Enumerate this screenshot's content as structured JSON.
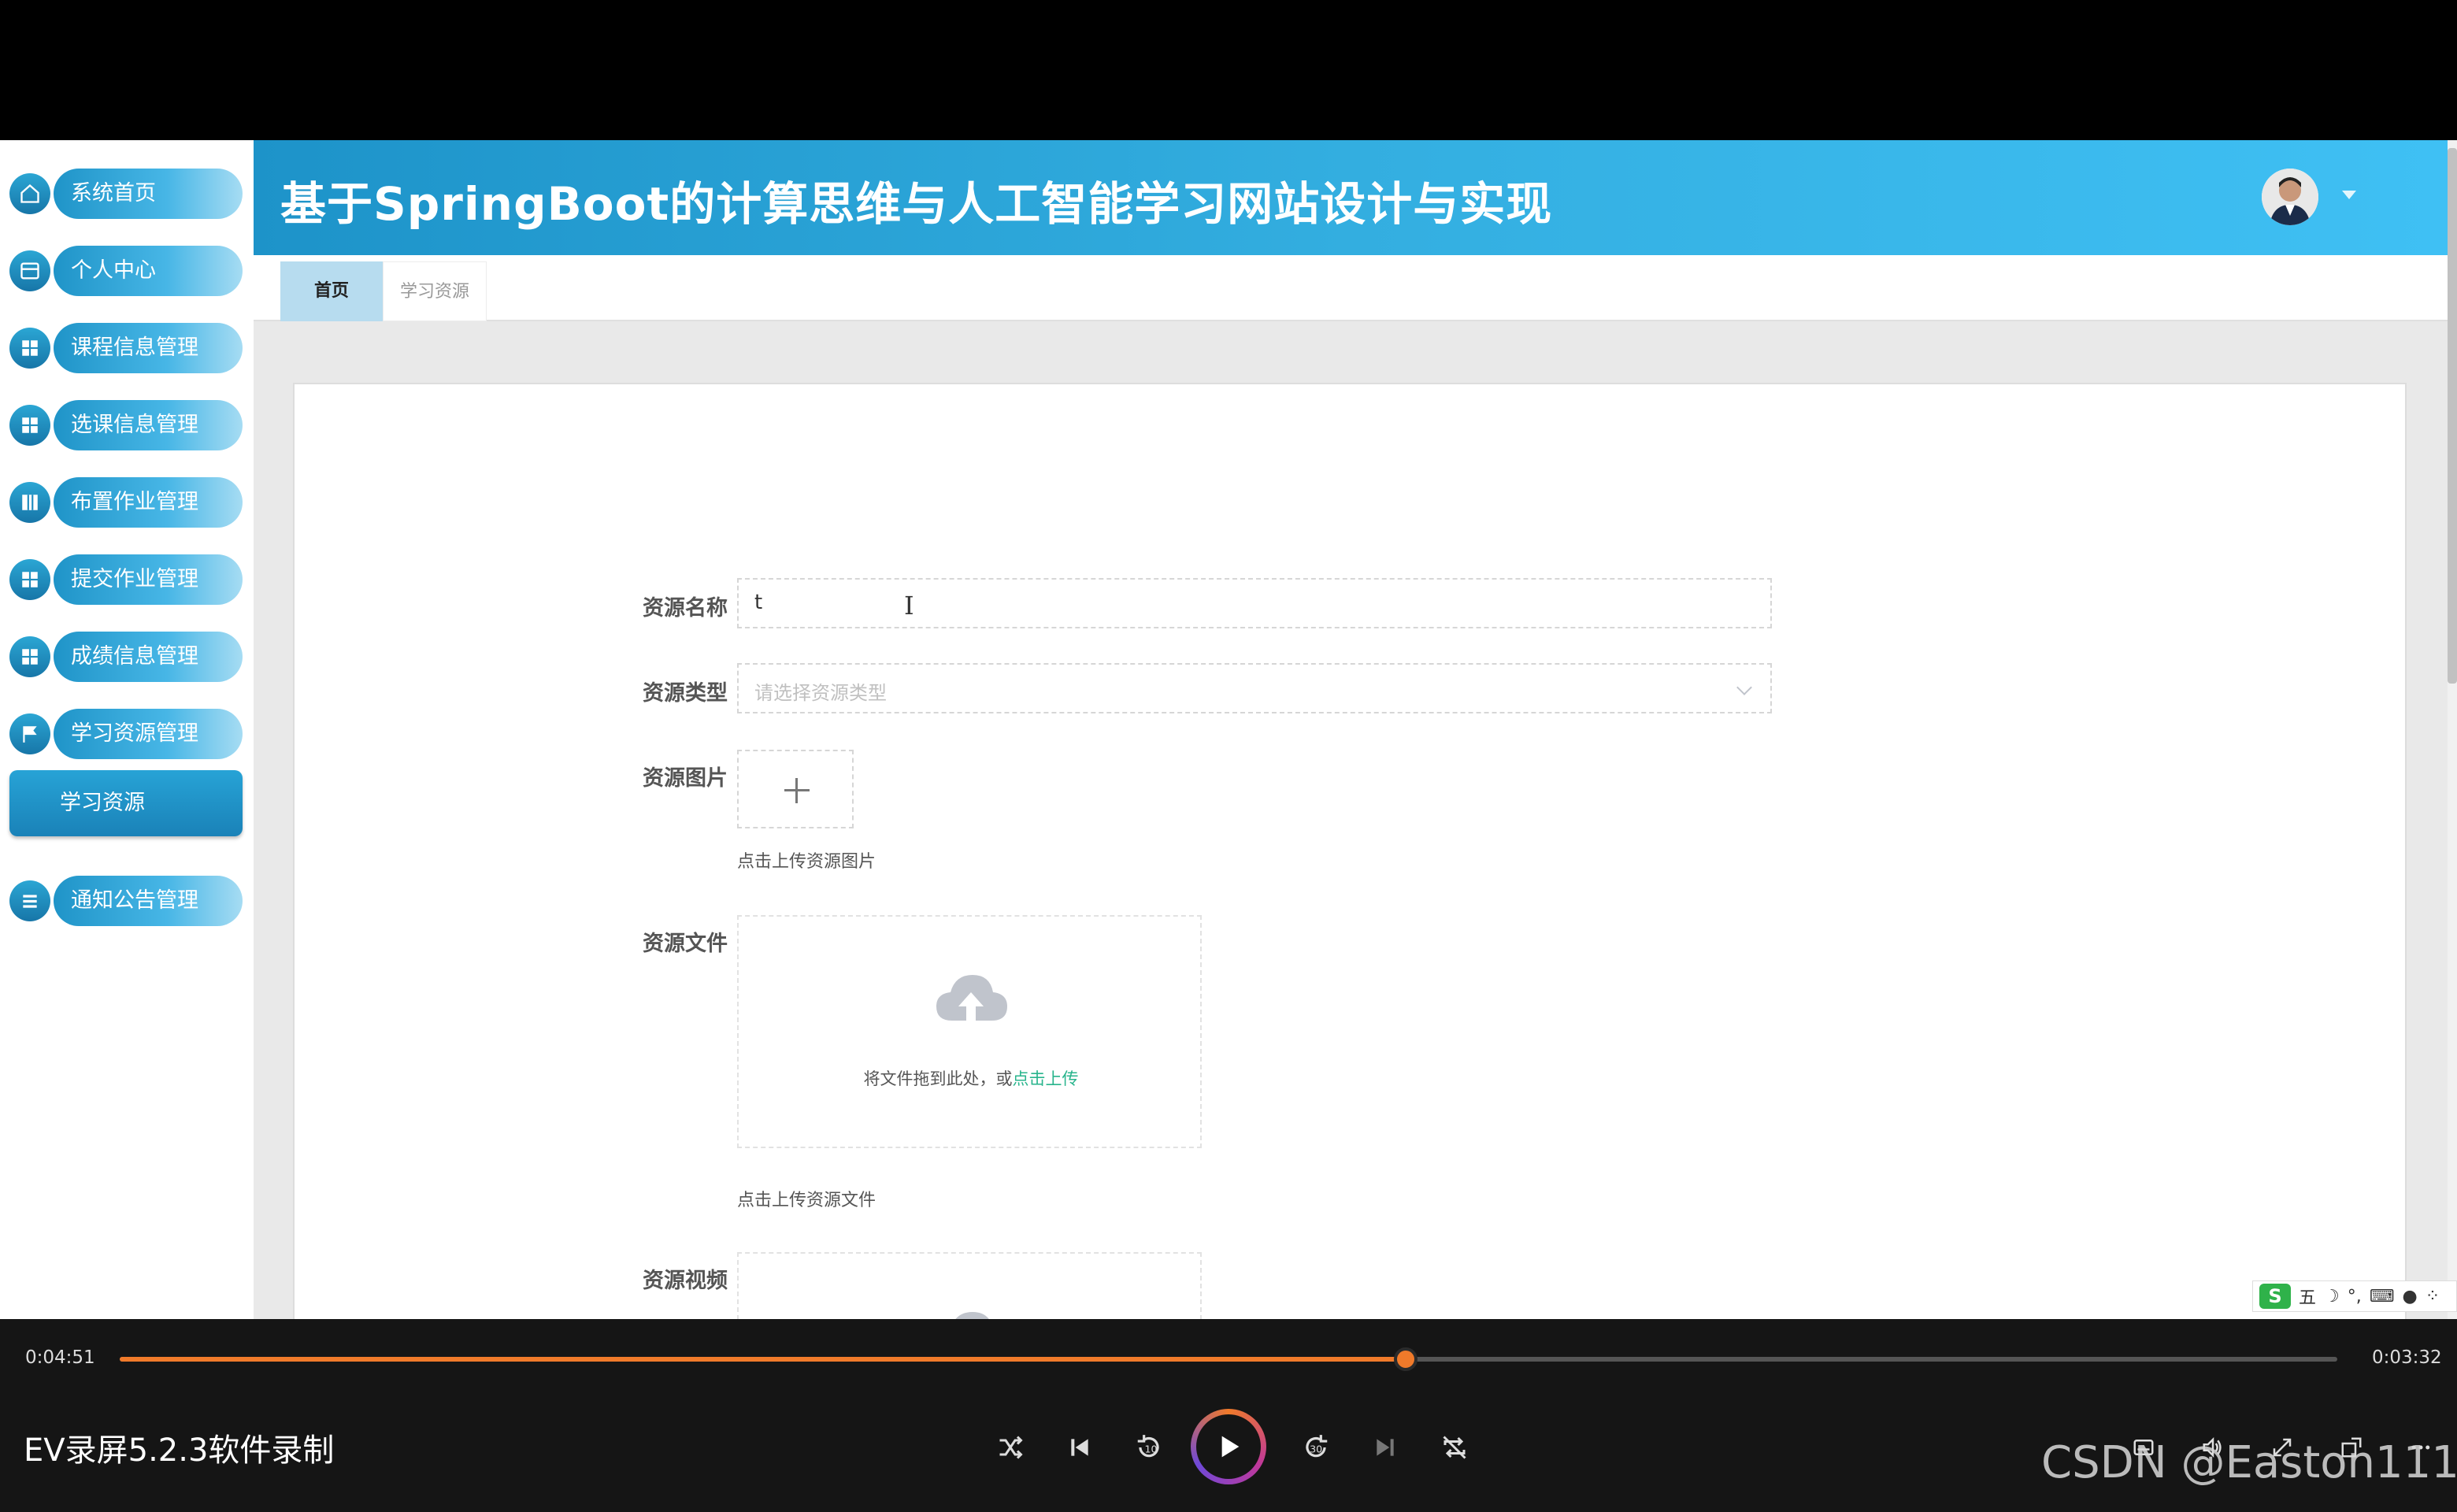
{
  "header": {
    "title": "基于SpringBoot的计算思维与人工智能学习网站设计与实现"
  },
  "sidebar": {
    "items": [
      {
        "label": "系统首页",
        "icon": "home-icon"
      },
      {
        "label": "个人中心",
        "icon": "profile-icon"
      },
      {
        "label": "课程信息管理",
        "icon": "grid-icon"
      },
      {
        "label": "选课信息管理",
        "icon": "grid-icon"
      },
      {
        "label": "布置作业管理",
        "icon": "book-icon"
      },
      {
        "label": "提交作业管理",
        "icon": "grid-icon"
      },
      {
        "label": "成绩信息管理",
        "icon": "grid-icon"
      },
      {
        "label": "学习资源管理",
        "icon": "flag-icon"
      },
      {
        "label": "通知公告管理",
        "icon": "list-icon"
      }
    ],
    "sub_item": "学习资源"
  },
  "tabs": [
    {
      "label": "首页",
      "active": true
    },
    {
      "label": "学习资源",
      "active": false
    }
  ],
  "form": {
    "name_label": "资源名称",
    "name_value": "t",
    "type_label": "资源类型",
    "type_placeholder": "请选择资源类型",
    "image_label": "资源图片",
    "image_hint": "点击上传资源图片",
    "file_label": "资源文件",
    "file_hint": "点击上传资源文件",
    "video_label": "资源视频",
    "drop_text": "将文件拖到此处，或",
    "drop_link": "点击上传"
  },
  "ime": {
    "logo": "S",
    "mode": "五"
  },
  "player": {
    "elapsed": "0:04:51",
    "remaining": "0:03:32",
    "progress_fraction": 0.58,
    "title": "EV录屏5.2.3软件录制",
    "accent": "#f07a2a"
  },
  "watermark": "CSDN @Easton111",
  "colors": {
    "header_start": "#1d93c9",
    "header_end": "#3fc0f4",
    "link": "#28b48c"
  }
}
